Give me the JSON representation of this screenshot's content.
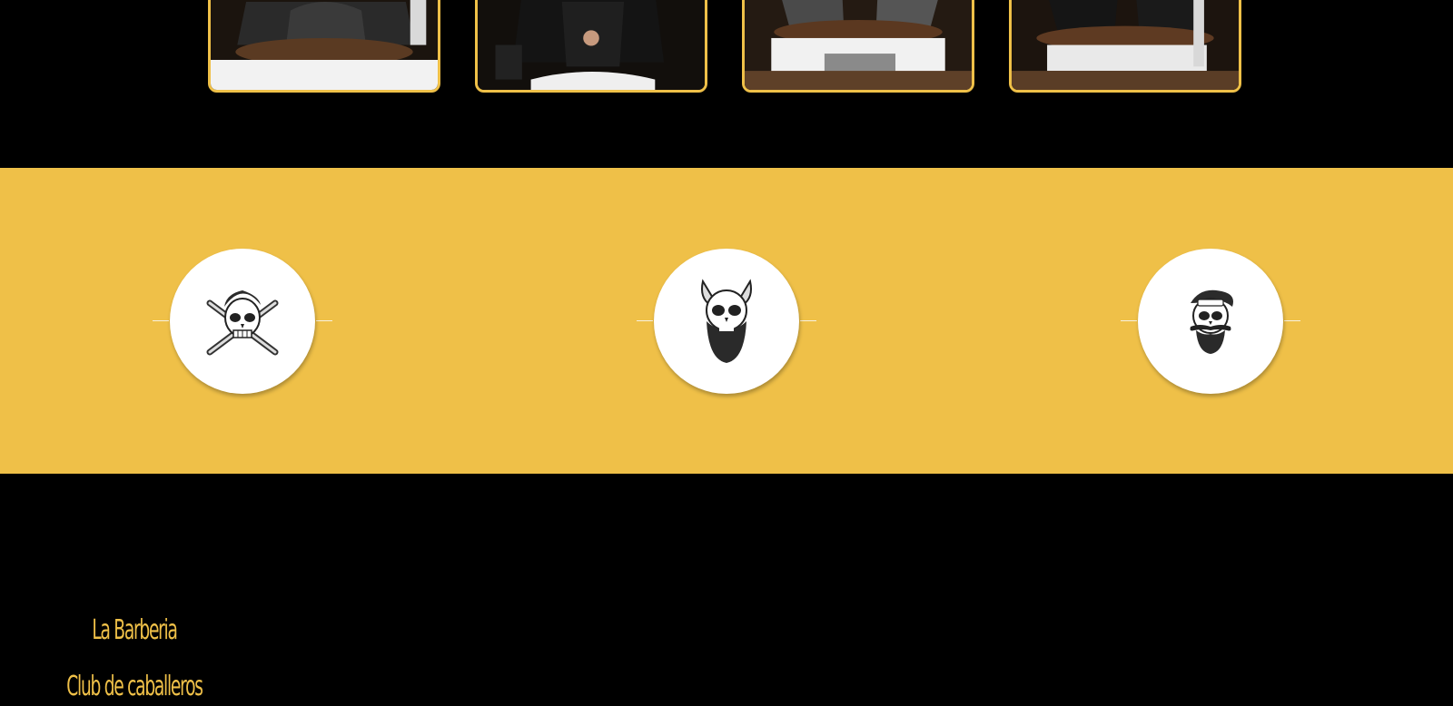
{
  "team_gallery": {
    "cards": [
      {
        "photo_icon": "barber-seated-photo-1",
        "has_caption_strip": true
      },
      {
        "photo_icon": "barber-seated-photo-2",
        "has_caption_strip": false
      },
      {
        "photo_icon": "barber-seated-photo-3",
        "has_caption_strip": false
      },
      {
        "photo_icon": "barber-seated-photo-4",
        "has_caption_strip": false
      }
    ]
  },
  "feature_band": {
    "background_color": "#efc048",
    "badges": [
      {
        "icon": "skull-crossed-razors-icon"
      },
      {
        "icon": "horned-bearded-skull-icon"
      },
      {
        "icon": "hipster-skull-mustache-icon"
      }
    ]
  },
  "footer": {
    "brand_line1": "La Barberia",
    "brand_line2": "Club de caballeros",
    "accent_color": "#efc048"
  }
}
